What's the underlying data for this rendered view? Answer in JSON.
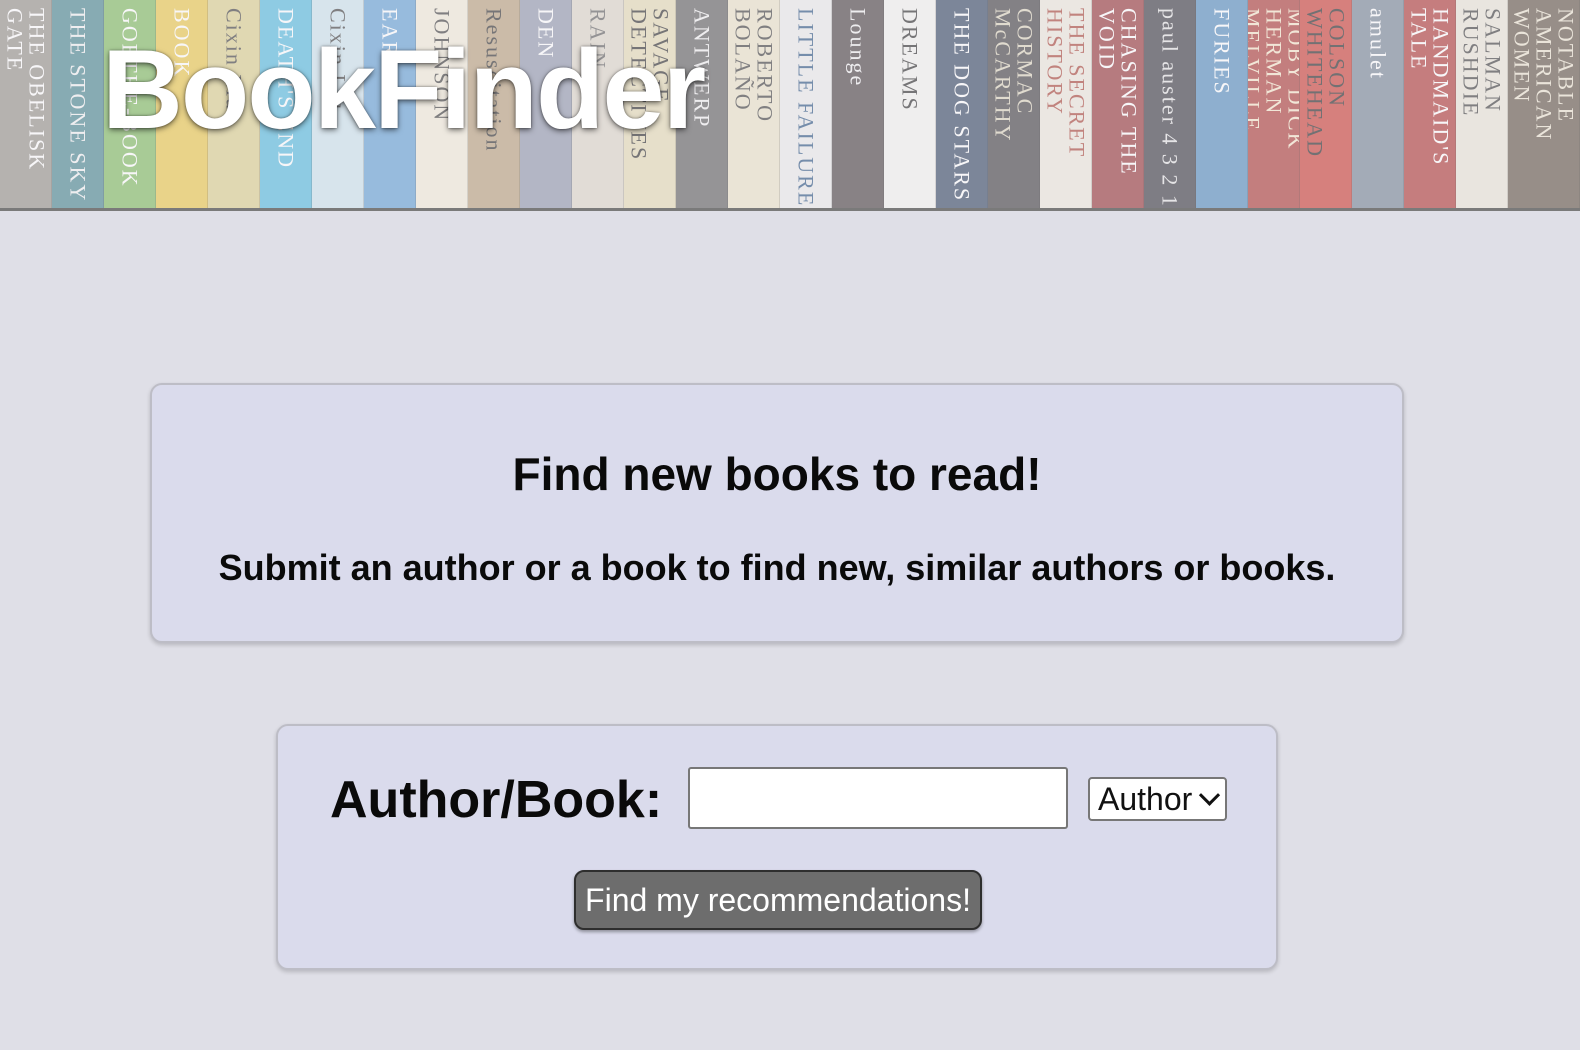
{
  "header": {
    "logo_text": "BookFinder",
    "banner_spines": [
      {
        "text": "THE OBELISK GATE",
        "bg": "#8e8a82",
        "fg": "#ffffff"
      },
      {
        "text": "THE STONE SKY",
        "bg": "#3f7e88",
        "fg": "#f2f2f2"
      },
      {
        "text": "GOETHE-BOOK",
        "bg": "#78b656",
        "fg": "#ffffff"
      },
      {
        "text": "BOOK",
        "bg": "#e7c341",
        "fg": "#ffffff"
      },
      {
        "text": "Cixin Liu",
        "bg": "#d8cb87",
        "fg": "#333333"
      },
      {
        "text": "DEATH'S END",
        "bg": "#4bb5db",
        "fg": "#ffffff"
      },
      {
        "text": "Cixin Liu",
        "bg": "#c8e0ea",
        "fg": "#333333"
      },
      {
        "text": "EARTH",
        "bg": "#5b9ad1",
        "fg": "#ffffff"
      },
      {
        "text": "JOHNSON",
        "bg": "#efe9d6",
        "fg": "#333333"
      },
      {
        "text": "Resuscitation",
        "bg": "#b39a76",
        "fg": "#222222"
      },
      {
        "text": "DEN",
        "bg": "#8a92a8",
        "fg": "#ffffff"
      },
      {
        "text": "RAIN",
        "bg": "#d9d2c4",
        "fg": "#555555"
      },
      {
        "text": "SAVAGE DETECTIVES",
        "bg": "#e2d7b0",
        "fg": "#222222"
      },
      {
        "text": "ANTWERP",
        "bg": "#575757",
        "fg": "#f0f0f0"
      },
      {
        "text": "ROBERTO BOLAÑO",
        "bg": "#e8e0c4",
        "fg": "#333333"
      },
      {
        "text": "LITTLE FAILURE",
        "bg": "#e9e9e9",
        "fg": "#1f4a7a"
      },
      {
        "text": "Lounge",
        "bg": "#40373a",
        "fg": "#f0f0f0"
      },
      {
        "text": "DREAMS",
        "bg": "#f2f1ee",
        "fg": "#222222"
      },
      {
        "text": "THE DOG STARS",
        "bg": "#2b3e5c",
        "fg": "#ffffff"
      },
      {
        "text": "CORMAC McCARTHY",
        "bg": "#38363a",
        "fg": "#d8d0b8"
      },
      {
        "text": "THE SECRET HISTORY",
        "bg": "#ebe6da",
        "fg": "#a33a2e"
      },
      {
        "text": "CHASING THE VOID",
        "bg": "#8f2b2f",
        "fg": "#ffffff"
      },
      {
        "text": "paul auster 4 3 2 1",
        "bg": "#2f2f37",
        "fg": "#e0e0e0"
      },
      {
        "text": "FURIES",
        "bg": "#4a86b8",
        "fg": "#ffffff"
      },
      {
        "text": "MOBY DICK HERMAN MELVILLE",
        "bg": "#a6312e",
        "fg": "#f4e4c6"
      },
      {
        "text": "COLSON WHITEHEAD",
        "bg": "#c7342c",
        "fg": "#1a1a1a"
      },
      {
        "text": "amulet",
        "bg": "#6f7e90",
        "fg": "#ffffff"
      },
      {
        "text": "HANDMAID'S TALE",
        "bg": "#a9302d",
        "fg": "#ffffff"
      },
      {
        "text": "SALMAN RUSHDIE",
        "bg": "#e7e2d4",
        "fg": "#333333"
      },
      {
        "text": "NOTABLE AMERICAN WOMEN",
        "bg": "#5a4d3e",
        "fg": "#e8e0cc"
      }
    ]
  },
  "intro": {
    "heading": "Find new books to read!",
    "subheading": "Submit an author or a book to find new, similar authors or books."
  },
  "search": {
    "label": "Author/Book:",
    "input_value": "",
    "type_selected": "Author",
    "submit_label": "Find my recommendations!"
  }
}
